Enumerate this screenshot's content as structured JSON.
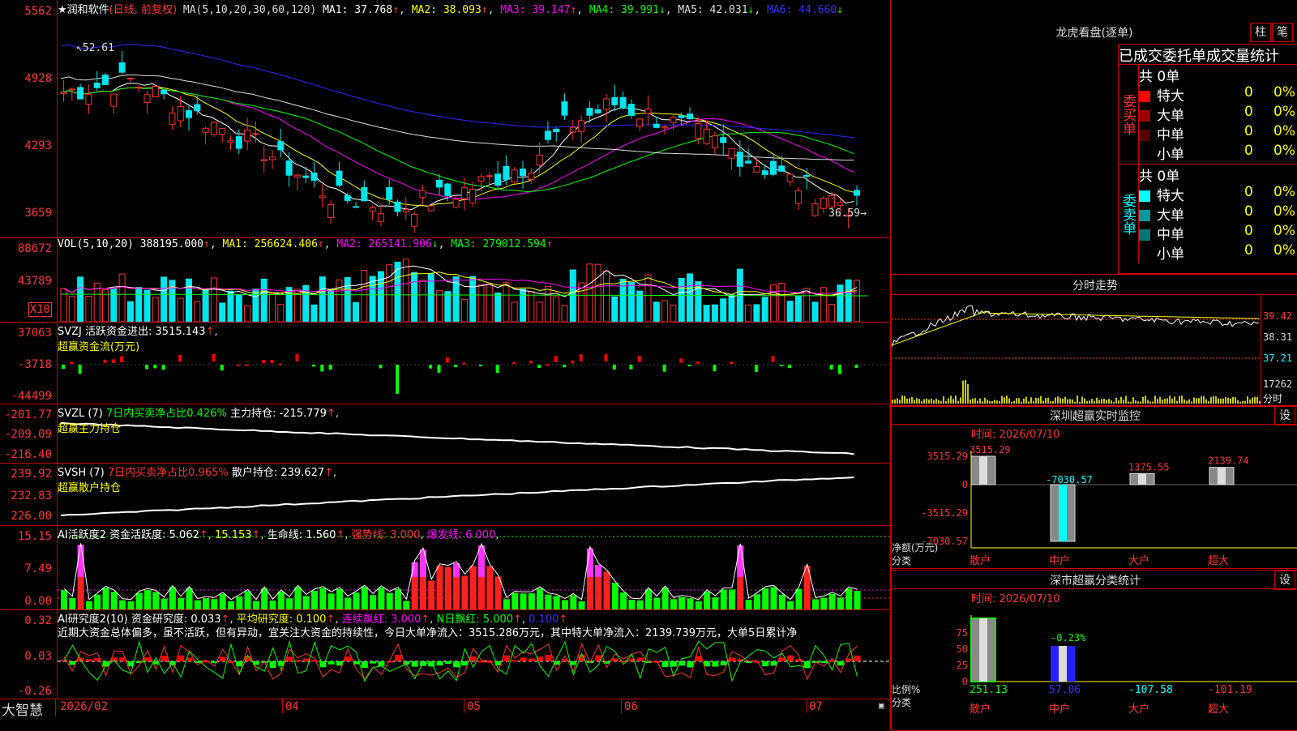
{
  "price": {
    "ticks": [
      "5562",
      "4928",
      "4293",
      "3659"
    ],
    "legend": {
      "name": "★润和软件",
      "mode": "(日线, 前复权)",
      "ma_label": "MA(5,10,20,30,60,120)",
      "ma1": "MA1: 37.768",
      "ma2": "MA2: 38.093",
      "ma3": "MA3: 39.147",
      "ma4": "MA4: 39.991",
      "ma5": "MA5: 42.031",
      "ma6": "MA6: 44.660"
    },
    "high_label": "52.61",
    "low_label": "36.59",
    "ma_colors": [
      "#ffffff",
      "#ffff00",
      "#ff00ff",
      "#00ff00",
      "#dddddd",
      "#2a2aff"
    ]
  },
  "vol": {
    "ticks": [
      "88672",
      "43789"
    ],
    "unit": "X10",
    "legend": {
      "t1": "VOL(5,10,20) 388195.000",
      "t2": "MA1: 256624.406",
      "t3": "MA2: 265141.906",
      "t4": "MA3: 279012.594"
    }
  },
  "svzj": {
    "ticks": [
      "37063",
      "-3718",
      "-44499"
    ],
    "legend": {
      "t1": "SVZJ  活跃资金进出: 3515.143",
      "t2": "超赢资金流(万元)"
    }
  },
  "svzl": {
    "ticks": [
      "-201.77",
      "-209.09",
      "-216.40"
    ],
    "legend": {
      "t1": "SVZL (7)",
      "t2": "7日内买卖净占比0.426%",
      "t3": "主力持仓: -215.779",
      "t4": "超赢主力持仓"
    }
  },
  "svsh": {
    "ticks": [
      "239.92",
      "232.83",
      "226.00"
    ],
    "legend": {
      "t1": "SVSH (7)",
      "t2": "7日内买卖净占比0.965%",
      "t3": "散户持仓: 239.627",
      "t4": "超赢散户持仓"
    }
  },
  "ai1": {
    "ticks": [
      "15.15",
      "7.49",
      "0.00"
    ],
    "legend": {
      "t1": "AI活跃度2 资金活跃度: 5.062",
      "t2": "15.153",
      "t3": "生命线: 1.560",
      "t4": "强势线: 3.000",
      "t5": "爆发线: 6.000"
    }
  },
  "ai2": {
    "ticks": [
      "0.32",
      "0.03",
      "-0.26"
    ],
    "legend": {
      "t1": "AI研究度2(10) 资金研究度: 0.033",
      "t2": "平均研究度: 0.100",
      "t3": "连续飘红: 3.000",
      "t4": "N日飘红: 5.000",
      "t5": "0.100"
    },
    "text": "近期大资金总体偏多，虽不活跃，但有异动，宜关注大资金的持续性，今日大单净流入：3515.286万元，其中特大单净流入：2139.739万元，大单5日累计净"
  },
  "bottom": {
    "brand": "大智慧",
    "dates": [
      "2026/02",
      "04",
      "05",
      "06",
      "07"
    ]
  },
  "right": {
    "title": "龙虎看盘(逐单)",
    "btn_zhu": "柱",
    "btn_bi": "笔",
    "header": "已成交委托单成交量统计",
    "buy": {
      "label": "委买单",
      "total": "共 0单",
      "rows": [
        {
          "name": "特大",
          "count": "0",
          "pct": "0%",
          "color": "#ff0000"
        },
        {
          "name": "大单",
          "count": "0",
          "pct": "0%",
          "color": "#990000"
        },
        {
          "name": "中单",
          "count": "0",
          "pct": "0%",
          "color": "#550000"
        },
        {
          "name": "小单",
          "count": "0",
          "pct": "0%",
          "color": ""
        }
      ]
    },
    "sell": {
      "label": "委卖单",
      "total": "共 0单",
      "rows": [
        {
          "name": "特大",
          "count": "0",
          "pct": "0%",
          "color": "#00ffff"
        },
        {
          "name": "大单",
          "count": "0",
          "pct": "0%",
          "color": "#009999"
        },
        {
          "name": "中单",
          "count": "0",
          "pct": "0%",
          "color": "#007777"
        },
        {
          "name": "小单",
          "count": "0",
          "pct": "0%",
          "color": ""
        }
      ]
    },
    "intraday": {
      "title": "分时走势",
      "prices": [
        "39.42",
        "38.31",
        "37.21"
      ],
      "vol": "17262",
      "unit": "分时"
    },
    "sz_monitor": {
      "title": "深圳超赢实时监控",
      "set": "设",
      "time": "时间: 2026/07/10",
      "yticks": [
        "3515.29",
        "0",
        "-3515.29",
        "-7030.57"
      ],
      "ylabel": "净额(万元)",
      "xlabel": "分类",
      "categories": [
        "散户",
        "中户",
        "大户",
        "超大"
      ],
      "bar_labels": [
        "3515.29",
        "-7030.57",
        "1375.55",
        "2139.74"
      ]
    },
    "sz_class": {
      "title": "深市超赢分类统计",
      "set": "设",
      "time": "时间: 2026/07/10",
      "yticks": [
        "75",
        "50",
        "25",
        "0"
      ],
      "ylabel": "比例%",
      "xlabel": "分类",
      "categories": [
        "散户",
        "中户",
        "大户",
        "超大"
      ],
      "top_label": "-0.23%",
      "values": [
        "251.13",
        "57.06",
        "-107.58",
        "-101.19"
      ]
    }
  }
}
